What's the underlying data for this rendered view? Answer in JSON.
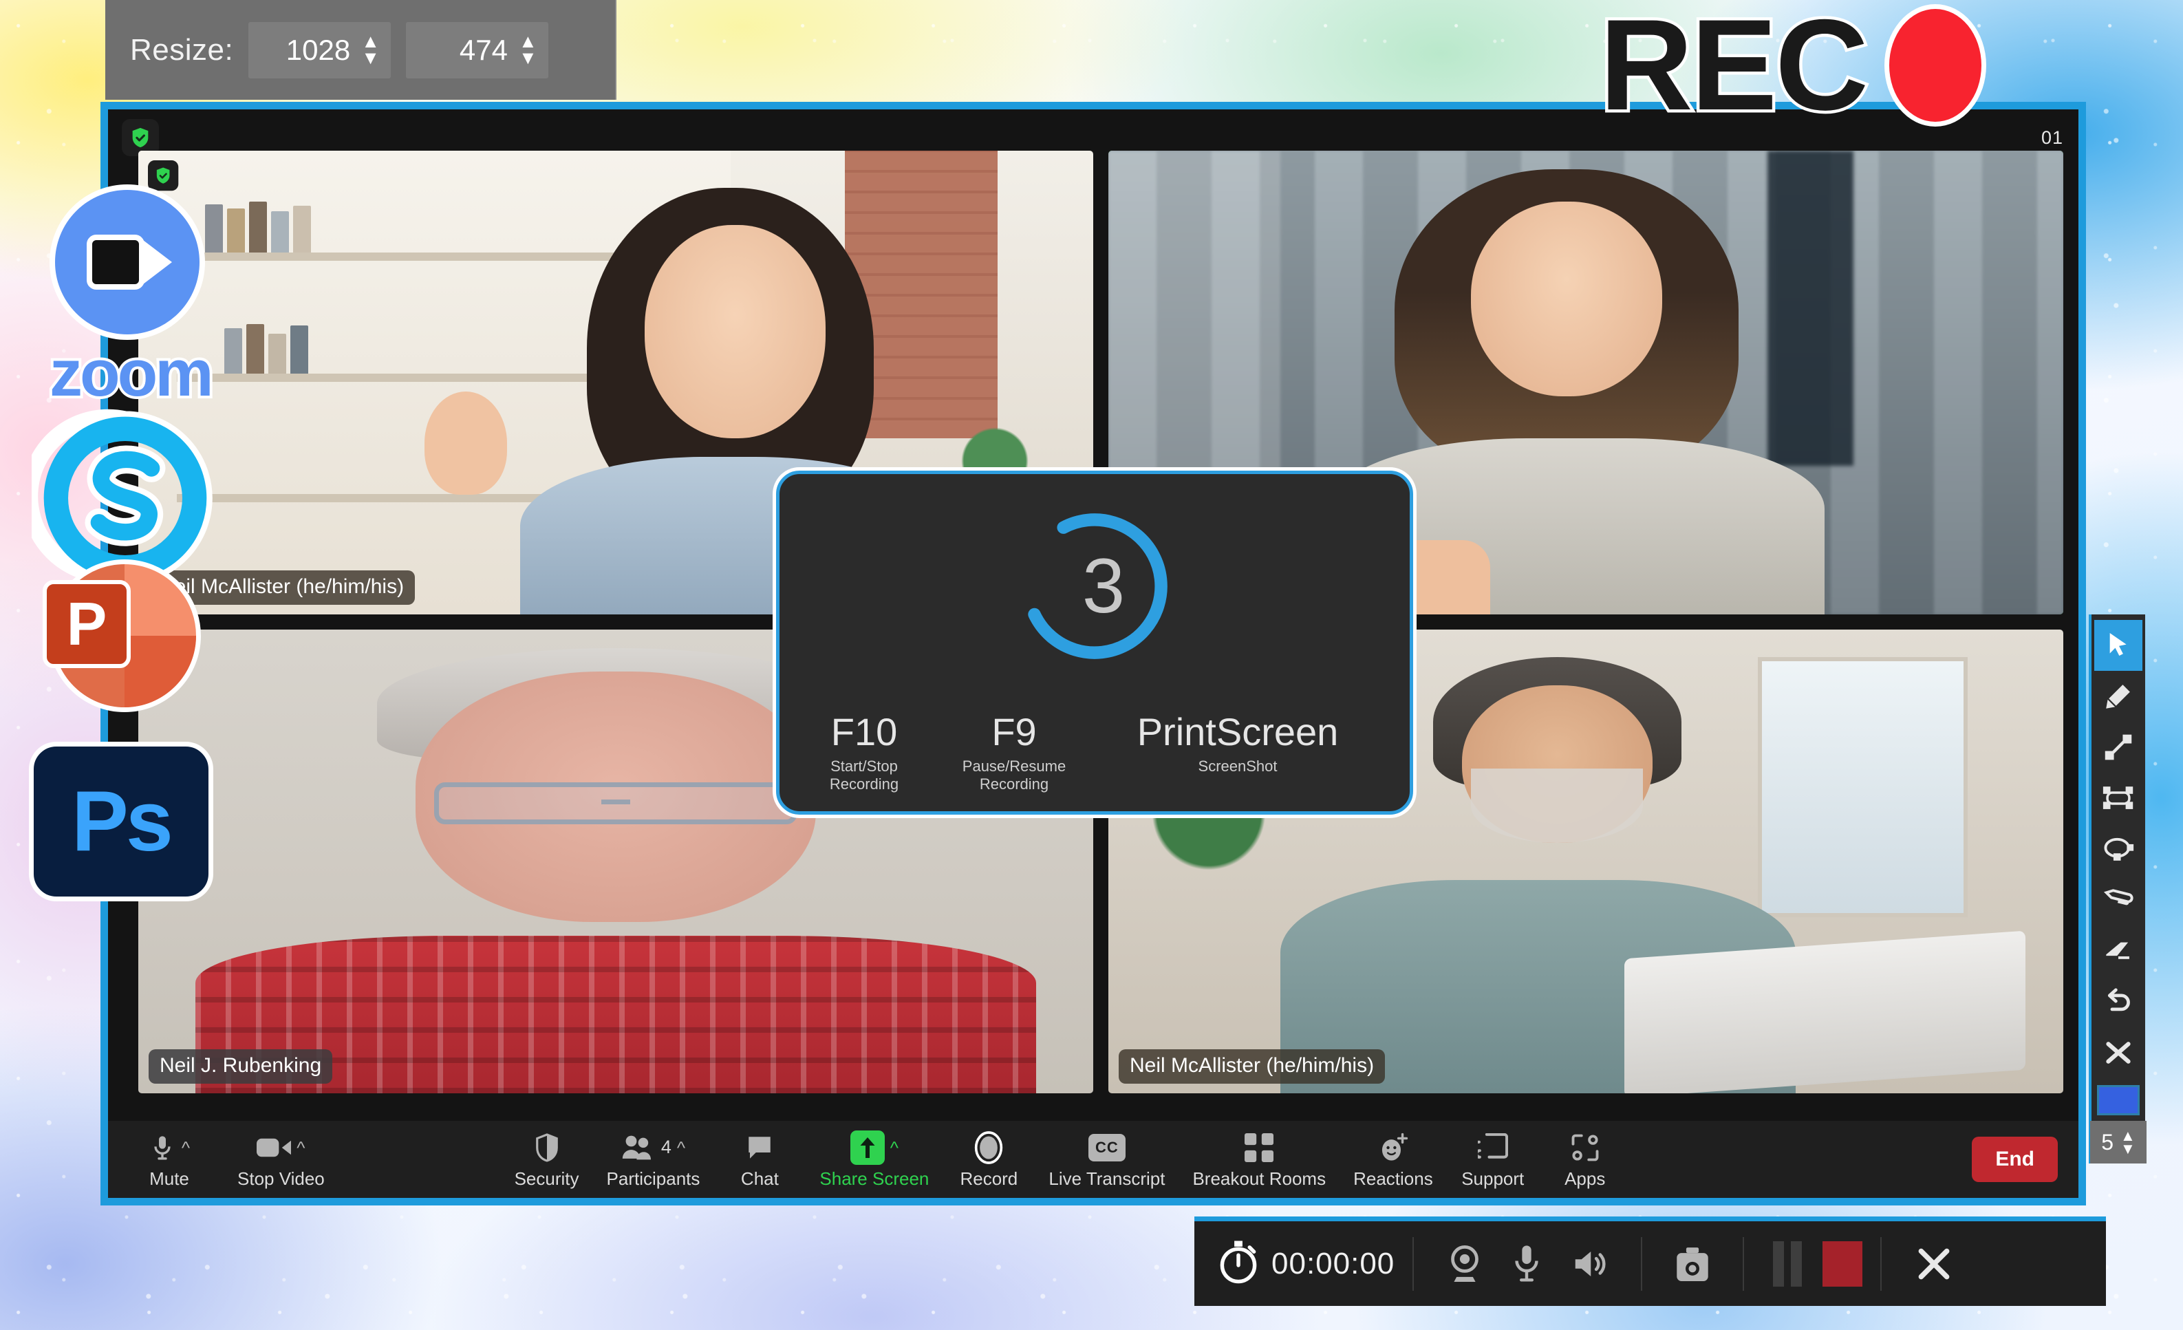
{
  "resize_toolbar": {
    "label": "Resize:",
    "width_value": "1028",
    "height_value": "474",
    "up_arrow": "▲",
    "down_arrow": "▼"
  },
  "rec_badge": {
    "text": "REC",
    "dot_color": "#f8232f"
  },
  "meeting": {
    "encryption_shield": "shield-check-icon",
    "header_timer": "01",
    "accent_border": "#1e9bdc",
    "active_speaker_border": "#2fd24f",
    "tiles": [
      {
        "name": "Neil McAllister (he/him/his)",
        "active": false,
        "shield": true
      },
      {
        "name": "",
        "active": true,
        "shield": false
      },
      {
        "name": "Neil J. Rubenking",
        "active": false,
        "shield": false
      },
      {
        "name": "Neil McAllister (he/him/his)",
        "active": false,
        "shield": false
      }
    ]
  },
  "countdown": {
    "number": "3",
    "ring_color": "#2e9fe0",
    "keys": [
      {
        "key": "F10",
        "sub": "Start/Stop Recording"
      },
      {
        "key": "F9",
        "sub": "Pause/Resume Recording"
      },
      {
        "key": "PrintScreen",
        "sub": "ScreenShot"
      }
    ]
  },
  "zoom_toolbar": {
    "left": [
      {
        "label": "Mute",
        "icon": "microphone-icon",
        "caret": "^"
      },
      {
        "label": "Stop Video",
        "icon": "video-camera-icon",
        "caret": "^"
      }
    ],
    "middle": [
      {
        "label": "Security",
        "icon": "shield-icon"
      },
      {
        "label": "Participants",
        "icon": "participants-icon",
        "count": "4",
        "caret": "^"
      },
      {
        "label": "Chat",
        "icon": "chat-bubble-icon"
      },
      {
        "label": "Share Screen",
        "icon": "share-arrow-up-icon",
        "caret": "^",
        "highlight": "#2fd24f"
      },
      {
        "label": "Record",
        "icon": "record-circle-icon"
      },
      {
        "label": "Live Transcript",
        "icon": "cc-icon"
      },
      {
        "label": "Breakout Rooms",
        "icon": "grid-squares-icon"
      },
      {
        "label": "Reactions",
        "icon": "smiley-plus-icon"
      },
      {
        "label": "Support",
        "icon": "cast-screen-icon"
      },
      {
        "label": "Apps",
        "icon": "apps-icon"
      }
    ],
    "end_button": "End"
  },
  "annotation_toolbar": {
    "tools": [
      {
        "name": "select-cursor-tool",
        "selected": true
      },
      {
        "name": "pencil-tool",
        "selected": false
      },
      {
        "name": "line-tool",
        "selected": false
      },
      {
        "name": "rectangle-shape-tool",
        "selected": false
      },
      {
        "name": "lasso-shape-tool",
        "selected": false
      },
      {
        "name": "eraser-tool",
        "selected": false
      },
      {
        "name": "highlighter-tool",
        "selected": false
      },
      {
        "name": "undo-tool",
        "selected": false
      },
      {
        "name": "clear-close-tool",
        "selected": false
      }
    ],
    "color_swatch": "#3561e0",
    "size_value": "5",
    "up_arrow": "▲",
    "down_arrow": "▼"
  },
  "recorder_bar": {
    "time": "00:00:00",
    "timer_icon": "stopwatch-icon",
    "buttons": [
      {
        "name": "webcam-toggle",
        "icon": "webcam-icon"
      },
      {
        "name": "microphone-toggle",
        "icon": "microphone-icon"
      },
      {
        "name": "speaker-toggle",
        "icon": "speaker-icon"
      },
      {
        "name": "screenshot-button",
        "icon": "camera-icon"
      }
    ],
    "pause_label": "pause-button",
    "stop_label": "stop-button",
    "stop_color": "#a5222a",
    "close_label": "close-button"
  },
  "app_rail": {
    "items": [
      {
        "name": "zoom-app-icon",
        "wordmark": "zoom"
      },
      {
        "name": "skype-app-icon",
        "wordmark": ""
      },
      {
        "name": "powerpoint-app-icon",
        "letter": "P"
      },
      {
        "name": "photoshop-app-icon",
        "letter": "Ps"
      }
    ]
  }
}
